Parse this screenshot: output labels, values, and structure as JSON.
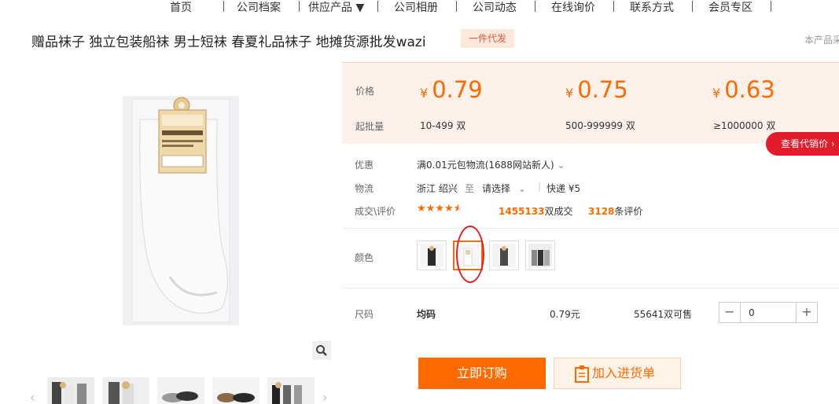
{
  "nav": {
    "items": [
      "首页",
      "公司档案",
      "供应产品 ▼",
      "公司相册",
      "公司动态",
      "在线询价",
      "联系方式",
      "会员专区"
    ]
  },
  "product": {
    "title": "赠品袜子 独立包装船袜 男士短袜 春夏礼品袜子 地摊货源批发wazi",
    "badge": "一件代发",
    "right_note": "本产品采"
  },
  "price_box": {
    "price_label": "价格",
    "moq_label": "起批量",
    "currency": "¥",
    "tiers": [
      {
        "price": "0.79",
        "qty": "10-499 双"
      },
      {
        "price": "0.75",
        "qty": "500-999999 双"
      },
      {
        "price": "0.63",
        "qty": "≥1000000 双"
      }
    ],
    "agent_button": "查看代销价"
  },
  "details": {
    "promo_label": "优惠",
    "promo_text": "满0.01元包物流(1688网站新人)",
    "logistics_label": "物流",
    "origin": "浙江 绍兴",
    "to": "至",
    "destination": "请选择",
    "shipping": "快递 ¥5",
    "deal_label": "成交\\评价",
    "rating": 4.5,
    "deals_count": "1455133",
    "deals_unit": "双成交",
    "reviews_count": "3128",
    "reviews_unit": "条评价"
  },
  "color": {
    "label": "颜色",
    "selected_index": 1,
    "swatches": [
      "black-sock-swatch",
      "white-sock-swatch",
      "dark-sock-swatch",
      "grey-sock-swatch"
    ]
  },
  "size_row": {
    "label": "尺码",
    "size": "均码",
    "price": "0.79元",
    "stock": "55641双可售",
    "quantity": "0"
  },
  "actions": {
    "order": "立即订购",
    "cart": "加入进货单"
  },
  "colors": {
    "accent": "#ff6a00",
    "agent_red": "#e21c2b",
    "price_bg": "#fdf1ea"
  }
}
